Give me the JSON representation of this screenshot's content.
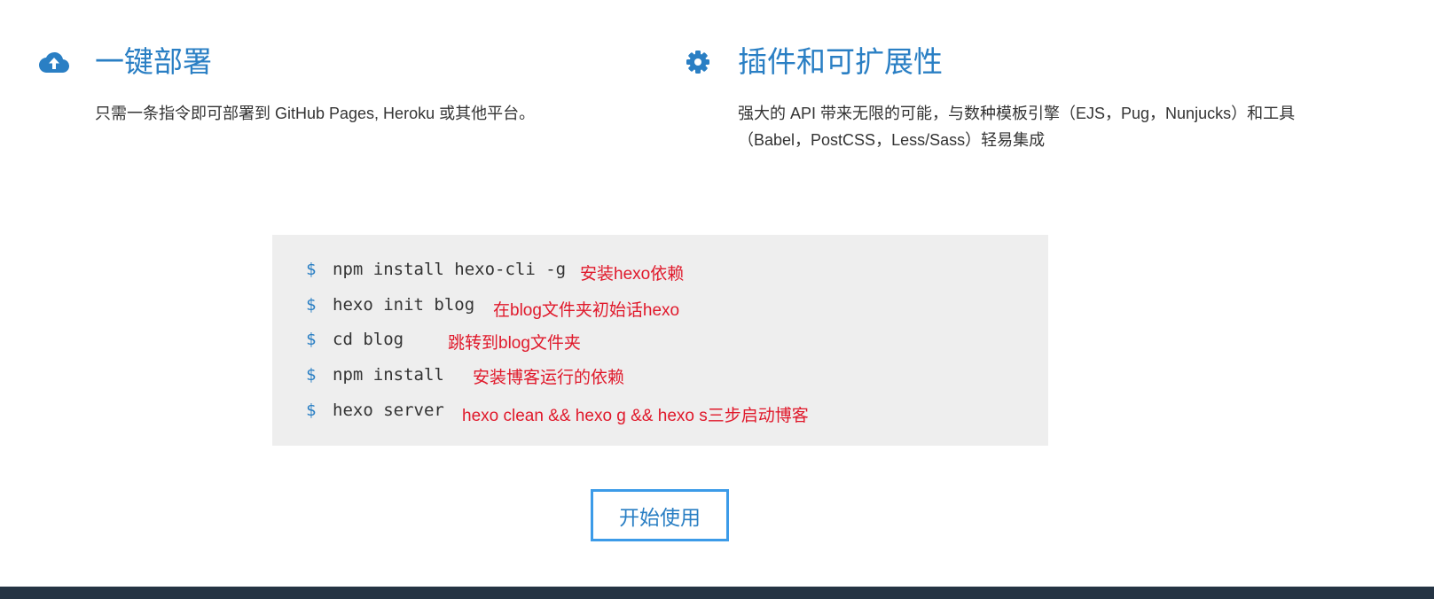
{
  "features": {
    "deploy": {
      "icon": "cloud-upload-icon",
      "title": "一键部署",
      "description": "只需一条指令即可部署到 GitHub Pages, Heroku 或其他平台。"
    },
    "plugins": {
      "icon": "gear-icon",
      "title": "插件和可扩展性",
      "description": "强大的 API 带来无限的可能，与数种模板引擎（EJS，Pug，Nunjucks）和工具（Babel，PostCSS，Less/Sass）轻易集成"
    }
  },
  "code": {
    "prompt": "$",
    "lines": [
      {
        "command": "npm install hexo-cli -g",
        "note": "安装hexo依赖"
      },
      {
        "command": "hexo init blog",
        "note": "在blog文件夹初始话hexo"
      },
      {
        "command": "cd blog",
        "note": "跳转到blog文件夹"
      },
      {
        "command": "npm install",
        "note": "安装博客运行的依赖"
      },
      {
        "command": "hexo server",
        "note": "hexo clean &&  hexo g && hexo s三步启动博客"
      }
    ]
  },
  "actions": {
    "start_label": "开始使用"
  },
  "colors": {
    "accent": "#2a7fc4",
    "button_border": "#3c9be8",
    "note_red": "#e0192b",
    "code_bg": "#eeeeee",
    "footer": "#253444"
  }
}
